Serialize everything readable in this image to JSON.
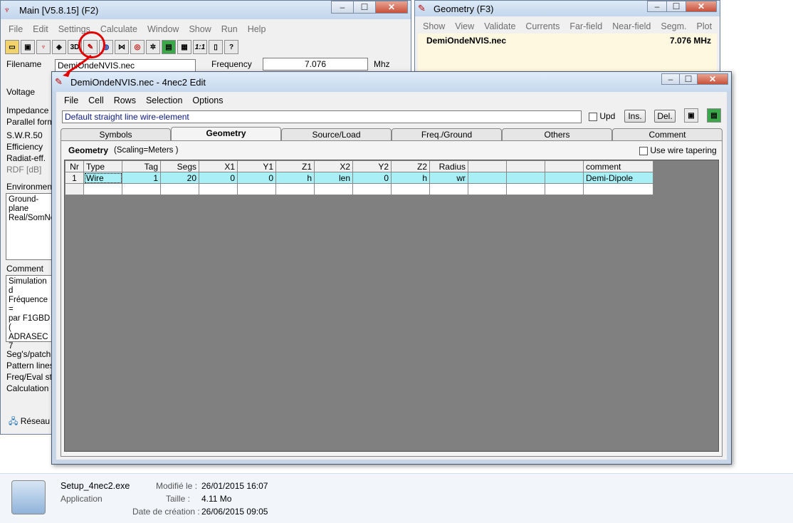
{
  "main_window": {
    "title": "Main [V5.8.15]  (F2)",
    "menu": [
      "File",
      "Edit",
      "Settings",
      "Calculate",
      "Window",
      "Show",
      "Run",
      "Help"
    ],
    "toolbar_text": {
      "three_d": "3D",
      "one_one": "1:1"
    },
    "filename_label": "Filename",
    "filename_value": "DemiOndeNVIS.nec",
    "frequency_label": "Frequency",
    "frequency_value": "7.076",
    "frequency_unit": "Mhz",
    "labels": [
      "Voltage",
      "Impedance",
      "Parallel form",
      "S.W.R.50",
      "Efficiency",
      "Radiat-eff.",
      "RDF [dB]"
    ],
    "environment_label": "Environment",
    "environment_lines": [
      "Ground-plane",
      "Real/SomNe"
    ],
    "comment_label": "Comment",
    "comment_lines": [
      "Simulation d",
      "Fréquence =",
      "par F1GBD (",
      "ADRASEC 7"
    ],
    "bottom_labels": [
      "Seg's/patche",
      "Pattern lines",
      "Freq/Eval ste",
      "Calculation tin"
    ]
  },
  "geometry_window": {
    "title": "Geometry   (F3)",
    "menu": [
      "Show",
      "View",
      "Validate",
      "Currents",
      "Far-field",
      "Near-field",
      "Segm.",
      "Plot"
    ],
    "file": "DemiOndeNVIS.nec",
    "freq": "7.076 MHz"
  },
  "edit_window": {
    "title": "DemiOndeNVIS.nec - 4nec2 Edit",
    "menu": [
      "File",
      "Cell",
      "Rows",
      "Selection",
      "Options"
    ],
    "description": "Default straight line wire-element",
    "upd_label": "Upd",
    "ins_label": "Ins.",
    "del_label": "Del.",
    "tabs": [
      "Symbols",
      "Geometry",
      "Source/Load",
      "Freq./Ground",
      "Others",
      "Comment"
    ],
    "active_tab": "Geometry",
    "section_title": "Geometry",
    "scaling": "(Scaling=Meters )",
    "tapering_label": "Use wire tapering",
    "columns": [
      "Nr",
      "Type",
      "Tag",
      "Segs",
      "X1",
      "Y1",
      "Z1",
      "X2",
      "Y2",
      "Z2",
      "Radius",
      "",
      "",
      "",
      "comment"
    ],
    "row1": [
      "1",
      "Wire",
      "1",
      "20",
      "0",
      "0",
      "h",
      "len",
      "0",
      "h",
      "wr",
      "",
      "",
      "",
      "Demi-Dipole"
    ]
  },
  "network_item": "Réseau",
  "file_info": {
    "name": "Setup_4nec2.exe",
    "type": "Application",
    "modified_label": "Modifié le :",
    "modified_value": "26/01/2015 16:07",
    "size_label": "Taille :",
    "size_value": "4.11 Mo",
    "created_label": "Date de création :",
    "created_value": "26/06/2015 09:05"
  },
  "colors": {
    "accent_cell": "#a8f0f6",
    "grid_bg": "#808080",
    "highlight_red": "#e00000"
  }
}
